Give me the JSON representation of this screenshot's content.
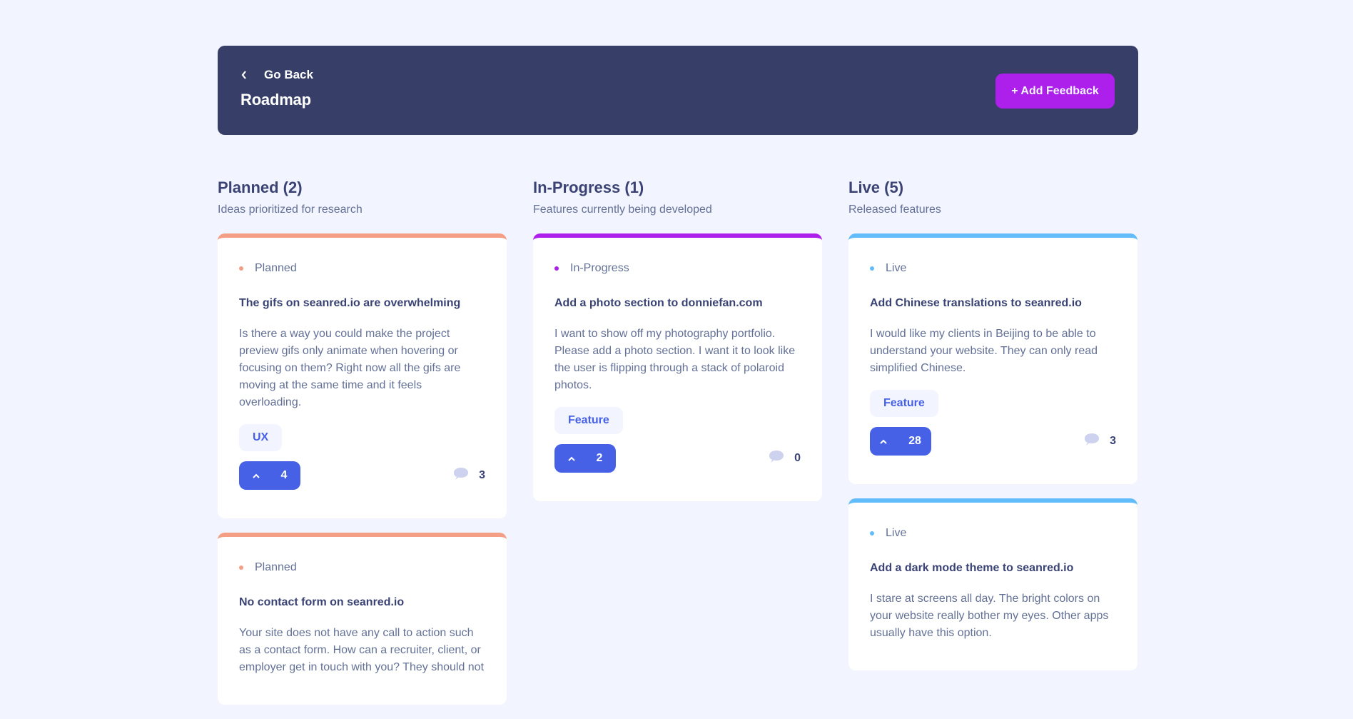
{
  "header": {
    "go_back": "Go Back",
    "title": "Roadmap",
    "add_feedback": "+ Add Feedback"
  },
  "colors": {
    "planned": "#F49F85",
    "in_progress": "#AD1FEA",
    "live": "#62BCFA"
  },
  "columns": [
    {
      "title": "Planned (2)",
      "description": "Ideas prioritized for research",
      "cards": [
        {
          "status": "Planned",
          "title": "The gifs on seanred.io are overwhelming",
          "description": "Is there a way you could make the project preview gifs only animate when hovering or focusing on them? Right now all the gifs are moving at the same time and it feels overloading.",
          "tag": "UX",
          "upvotes": "4",
          "comments": "3"
        },
        {
          "status": "Planned",
          "title": "No contact form on seanred.io",
          "description": "Your site does not have any call to action such as a contact form. How can a recruiter, client, or employer get in touch with you? They should not"
        }
      ]
    },
    {
      "title": "In-Progress (1)",
      "description": "Features currently being developed",
      "cards": [
        {
          "status": "In-Progress",
          "title": "Add a photo section to donniefan.com",
          "description": "I want to show off my photography portfolio. Please add a photo section. I want it to look like the user is flipping through a stack of polaroid photos.",
          "tag": "Feature",
          "upvotes": "2",
          "comments": "0"
        }
      ]
    },
    {
      "title": "Live (5)",
      "description": "Released features",
      "cards": [
        {
          "status": "Live",
          "title": "Add Chinese translations to seanred.io",
          "description": "I would like my clients in Beijing to be able to understand your website. They can only read simplified Chinese.",
          "tag": "Feature",
          "upvotes": "28",
          "comments": "3"
        },
        {
          "status": "Live",
          "title": "Add a dark mode theme to seanred.io",
          "description": "I stare at screens all day. The bright colors on your website really bother my eyes. Other apps usually have this option."
        }
      ]
    }
  ]
}
